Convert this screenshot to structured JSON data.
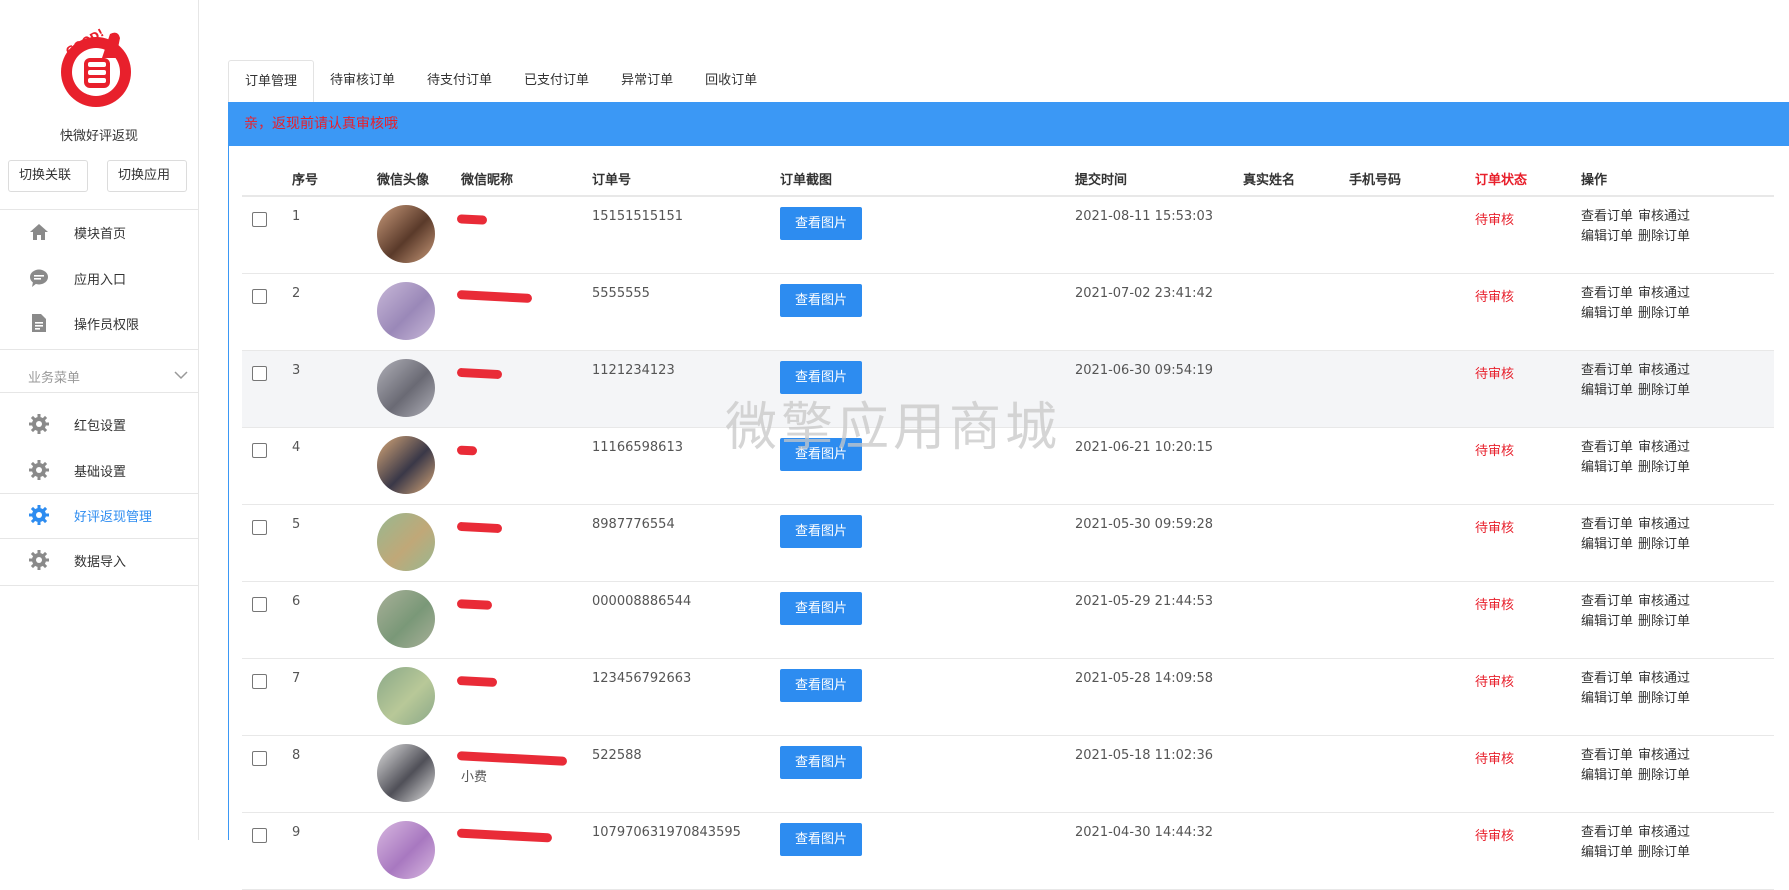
{
  "sidebar": {
    "app_name": "快微好评返现",
    "switch_link": "切换关联",
    "switch_app": "切换应用",
    "items": [
      {
        "label": "模块首页",
        "icon": "home-icon"
      },
      {
        "label": "应用入口",
        "icon": "chat-icon"
      },
      {
        "label": "操作员权限",
        "icon": "document-icon"
      }
    ],
    "group_label": "业务菜单",
    "biz_items": [
      {
        "label": "红包设置",
        "icon": "gear-icon"
      },
      {
        "label": "基础设置",
        "icon": "gear-icon"
      },
      {
        "label": "好评返现管理",
        "icon": "gear-icon",
        "active": true
      },
      {
        "label": "数据导入",
        "icon": "gear-icon"
      }
    ]
  },
  "tabs": [
    "订单管理",
    "待审核订单",
    "待支付订单",
    "已支付订单",
    "异常订单",
    "回收订单"
  ],
  "notice": "亲，返现前请认真审核哦",
  "table": {
    "headers": [
      "序号",
      "微信头像",
      "微信昵称",
      "订单号",
      "订单截图",
      "提交时间",
      "真实姓名",
      "手机号码",
      "订单状态",
      "操作"
    ],
    "view_label": "查看图片",
    "ops": [
      "查看订单",
      "审核通过",
      "编辑订单",
      "删除订单"
    ],
    "rows": [
      {
        "no": "1",
        "nick": "",
        "order": "15151515151",
        "time": "2021-08-11 15:53:03",
        "name": "",
        "phone": "",
        "status": "待审核"
      },
      {
        "no": "2",
        "nick": "",
        "order": "5555555",
        "time": "2021-07-02 23:41:42",
        "name": "",
        "phone": "",
        "status": "待审核"
      },
      {
        "no": "3",
        "nick": "",
        "order": "1121234123",
        "time": "2021-06-30 09:54:19",
        "name": "",
        "phone": "",
        "status": "待审核"
      },
      {
        "no": "4",
        "nick": "",
        "order": "11166598613",
        "time": "2021-06-21 10:20:15",
        "name": "",
        "phone": "",
        "status": "待审核"
      },
      {
        "no": "5",
        "nick": "",
        "order": "8987776554",
        "time": "2021-05-30 09:59:28",
        "name": "",
        "phone": "",
        "status": "待审核"
      },
      {
        "no": "6",
        "nick": "",
        "order": "000008886544",
        "time": "2021-05-29 21:44:53",
        "name": "",
        "phone": "",
        "status": "待审核"
      },
      {
        "no": "7",
        "nick": "",
        "order": "123456792663",
        "time": "2021-05-28 14:09:58",
        "name": "",
        "phone": "",
        "status": "待审核"
      },
      {
        "no": "8",
        "nick": "小费",
        "order": "522588",
        "time": "2021-05-18 11:02:36",
        "name": "",
        "phone": "",
        "status": "待审核"
      },
      {
        "no": "9",
        "nick": "",
        "order": "107970631970843595",
        "time": "2021-04-30 14:44:32",
        "name": "",
        "phone": "",
        "status": "待审核"
      }
    ]
  },
  "watermark": "微擎应用商城",
  "colors": {
    "accent": "#2d8cf0",
    "notice_bg": "#3b98f5",
    "status_red": "#e8202c"
  }
}
